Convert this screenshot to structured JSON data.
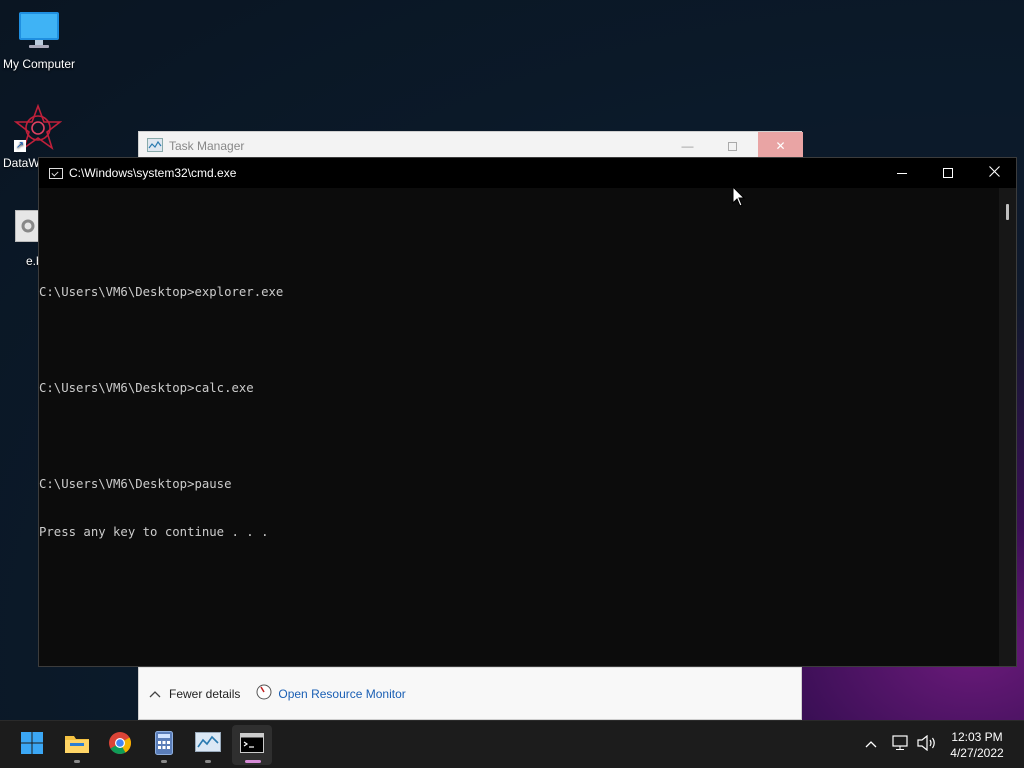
{
  "desktop": {
    "icons": [
      {
        "label": "My Computer"
      },
      {
        "label": "DataW"
      },
      {
        "label": "e.b"
      }
    ]
  },
  "task_manager": {
    "title": "Task Manager",
    "fewer_details": "Fewer details",
    "open_resource_monitor": "Open Resource Monitor"
  },
  "cmd": {
    "title": "C:\\Windows\\system32\\cmd.exe",
    "lines": [
      "",
      "C:\\Users\\VM6\\Desktop>explorer.exe",
      "",
      "C:\\Users\\VM6\\Desktop>calc.exe",
      "",
      "C:\\Users\\VM6\\Desktop>pause",
      "Press any key to continue . . ."
    ]
  },
  "taskbar": {
    "apps": [
      {
        "icon": "windows-start-icon"
      },
      {
        "icon": "file-explorer-icon"
      },
      {
        "icon": "chrome-icon"
      },
      {
        "icon": "calculator-icon"
      },
      {
        "icon": "task-manager-icon"
      },
      {
        "icon": "cmd-icon"
      }
    ],
    "clock_time": "12:03 PM",
    "clock_date": "4/27/2022"
  },
  "colors": {
    "cmd_bg": "#0c0c0c",
    "cmd_text": "#cccccc",
    "taskbar_bg": "#1c1c1c",
    "link_blue": "#1a5fb4"
  }
}
